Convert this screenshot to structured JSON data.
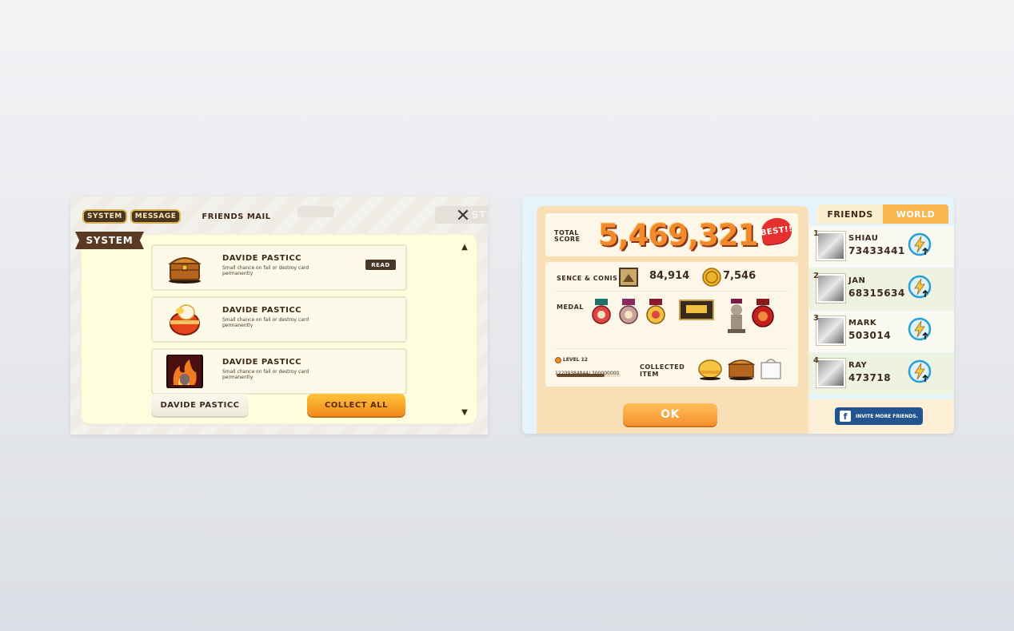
{
  "mail": {
    "tabs": [
      "SYSTEM",
      "MESSAGE"
    ],
    "friends_mail_tab": "FRIENDS MAIL",
    "ghost_stories": "STORIES",
    "section_ribbon": "SYSTEM",
    "close_glyph": "✕",
    "items": [
      {
        "sender": "DAVIDE PASTICC",
        "desc": "Small chance on fail or destroy card permanently",
        "icon": "treasure-chest-icon",
        "read_label": "READ"
      },
      {
        "sender": "DAVIDE PASTICC",
        "desc": "Small chance on fail or destroy card permanently",
        "icon": "egg-capsule-icon"
      },
      {
        "sender": "DAVIDE PASTICC",
        "desc": "Small chance on fail or destroy card permanently",
        "icon": "fire-card-icon"
      }
    ],
    "sender_button": "DAVIDE PASTICC",
    "collect_all_button": "COLLECT ALL",
    "scroll_up": "▲",
    "scroll_down": "▼"
  },
  "score": {
    "total_label_line1": "TOTAL",
    "total_label_line2": "SCORE",
    "total_value": "5,469,321",
    "best_badge": "BEST!!",
    "sence_label": "SENCE & CONIS",
    "sence_value": "84,914",
    "coins_value": "7,546",
    "medal_label": "MEDAL",
    "level_label": "LEVEL 12",
    "level_progress_text": "12209384844/ 300000000",
    "level_progress_fraction": 0.75,
    "collected_label_line1": "COLLECTED",
    "collected_label_line2": "ITEM",
    "ok_button": "OK"
  },
  "ranking": {
    "tabs": [
      "FRIENDS",
      "WORLD"
    ],
    "friends": [
      {
        "rank": "1",
        "name": "SHIAU",
        "score": "73433441"
      },
      {
        "rank": "2",
        "name": "JAN",
        "score": "68315634"
      },
      {
        "rank": "3",
        "name": "MARK",
        "score": "503014"
      },
      {
        "rank": "4",
        "name": "RAY",
        "score": "473718"
      }
    ],
    "invite_button": "INVITE MORE FRIENDS.",
    "fb_glyph": "f"
  },
  "colors": {
    "accent_orange": "#f18a2c",
    "brown_text": "#3d2a1a",
    "facebook_blue": "#22558f"
  }
}
